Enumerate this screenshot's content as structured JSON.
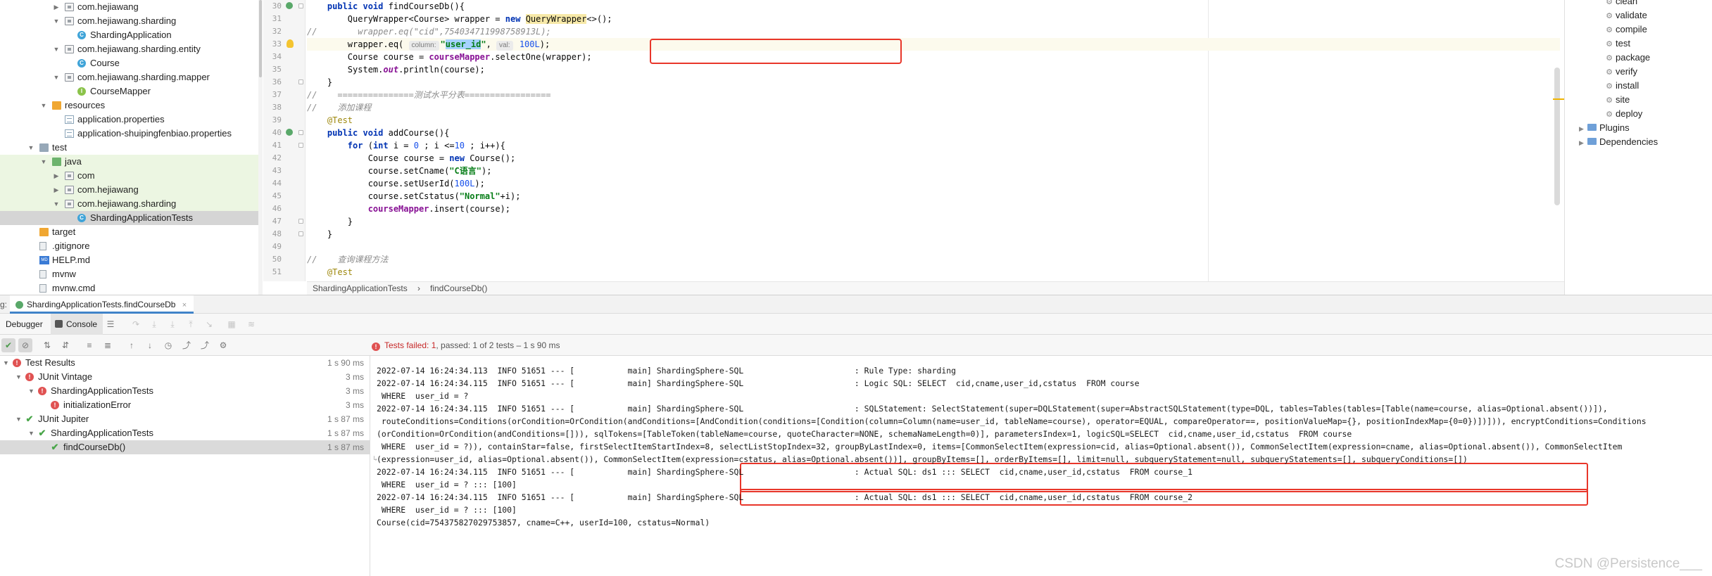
{
  "project_tree": [
    {
      "label": "com.hejiawang",
      "depth": 2,
      "icon": "package-icon",
      "arrow": "▶",
      "style": ""
    },
    {
      "label": "com.hejiawang.sharding",
      "depth": 2,
      "icon": "package-icon",
      "arrow": "▼",
      "style": ""
    },
    {
      "label": "ShardingApplication",
      "depth": 3,
      "icon": "class-icon",
      "arrow": "",
      "style": ""
    },
    {
      "label": "com.hejiawang.sharding.entity",
      "depth": 2,
      "icon": "package-icon",
      "arrow": "▼",
      "style": ""
    },
    {
      "label": "Course",
      "depth": 3,
      "icon": "class-icon",
      "arrow": "",
      "style": ""
    },
    {
      "label": "com.hejiawang.sharding.mapper",
      "depth": 2,
      "icon": "package-icon",
      "arrow": "▼",
      "style": ""
    },
    {
      "label": "CourseMapper",
      "depth": 3,
      "icon": "interface-icon",
      "arrow": "",
      "style": ""
    },
    {
      "label": "resources",
      "depth": 1,
      "icon": "resources-folder-icon",
      "arrow": "▼",
      "style": ""
    },
    {
      "label": "application.properties",
      "depth": 2,
      "icon": "properties-file-icon",
      "arrow": "",
      "style": ""
    },
    {
      "label": "application-shuipingfenbiao.properties",
      "depth": 2,
      "icon": "properties-file-icon",
      "arrow": "",
      "style": ""
    },
    {
      "label": "test",
      "depth": 0,
      "icon": "folder-icon",
      "arrow": "▼",
      "style": ""
    },
    {
      "label": "java",
      "depth": 1,
      "icon": "test-folder-icon",
      "arrow": "▼",
      "style": "green"
    },
    {
      "label": "com",
      "depth": 2,
      "icon": "package-icon",
      "arrow": "▶",
      "style": "green"
    },
    {
      "label": "com.hejiawang",
      "depth": 2,
      "icon": "package-icon",
      "arrow": "▶",
      "style": "green"
    },
    {
      "label": "com.hejiawang.sharding",
      "depth": 2,
      "icon": "package-icon",
      "arrow": "▼",
      "style": "green"
    },
    {
      "label": "ShardingApplicationTests",
      "depth": 3,
      "icon": "class-icon",
      "arrow": "",
      "style": "sel"
    },
    {
      "label": "target",
      "depth": 0,
      "icon": "excluded-folder-icon",
      "arrow": "",
      "style": ""
    },
    {
      "label": ".gitignore",
      "depth": 0,
      "icon": "file-icon",
      "arrow": "",
      "style": ""
    },
    {
      "label": "HELP.md",
      "depth": 0,
      "icon": "markdown-file-icon",
      "arrow": "",
      "style": ""
    },
    {
      "label": "mvnw",
      "depth": 0,
      "icon": "file-icon",
      "arrow": "",
      "style": ""
    },
    {
      "label": "mvnw.cmd",
      "depth": 0,
      "icon": "file-icon",
      "arrow": "",
      "style": ""
    }
  ],
  "editor": {
    "line_numbers": [
      "30",
      "31",
      "32",
      "33",
      "34",
      "35",
      "36",
      "37",
      "38",
      "39",
      "40",
      "41",
      "42",
      "43",
      "44",
      "45",
      "46",
      "47",
      "48",
      "49",
      "50",
      "51"
    ],
    "inlay_column": "column:",
    "inlay_val": "val:",
    "breadcrumb_class": "ShardingApplicationTests",
    "breadcrumb_method": "findCourseDb()"
  },
  "maven": {
    "lifecycle": [
      "clean",
      "validate",
      "compile",
      "test",
      "package",
      "verify",
      "install",
      "site",
      "deploy"
    ],
    "plugins_label": "Plugins",
    "dependencies_label": "Dependencies"
  },
  "run_panel": {
    "tab_prefix": "g:",
    "tab_label": "ShardingApplicationTests.findCourseDb",
    "tab_close": "×",
    "debugger_tab": "Debugger",
    "console_tab": "Console",
    "status_fail": "Tests failed: 1",
    "status_rest": ", passed: 1 of 2 tests – 1 s 90 ms"
  },
  "test_results": [
    {
      "name": "Test Results",
      "time": "1 s 90 ms",
      "depth": 0,
      "status": "fail",
      "arrow": "▼",
      "selected": false
    },
    {
      "name": "JUnit Vintage",
      "time": "3 ms",
      "depth": 1,
      "status": "fail",
      "arrow": "▼",
      "selected": false
    },
    {
      "name": "ShardingApplicationTests",
      "time": "3 ms",
      "depth": 2,
      "status": "fail",
      "arrow": "▼",
      "selected": false
    },
    {
      "name": "initializationError",
      "time": "3 ms",
      "depth": 3,
      "status": "fail",
      "arrow": "",
      "selected": false
    },
    {
      "name": "JUnit Jupiter",
      "time": "1 s 87 ms",
      "depth": 1,
      "status": "pass",
      "arrow": "▼",
      "selected": false
    },
    {
      "name": "ShardingApplicationTests",
      "time": "1 s 87 ms",
      "depth": 2,
      "status": "pass",
      "arrow": "▼",
      "selected": false
    },
    {
      "name": "findCourseDb()",
      "time": "1 s 87 ms",
      "depth": 3,
      "status": "pass",
      "arrow": "",
      "selected": true
    }
  ],
  "console_lines": [
    "2022-07-14 16:24:34.113  INFO 51651 --- [           main] ShardingSphere-SQL                       : Rule Type: sharding",
    "2022-07-14 16:24:34.115  INFO 51651 --- [           main] ShardingSphere-SQL                       : Logic SQL: SELECT  cid,cname,user_id,cstatus  FROM course",
    " WHERE  user_id = ?",
    "2022-07-14 16:24:34.115  INFO 51651 --- [           main] ShardingSphere-SQL                       : SQLStatement: SelectStatement(super=DQLStatement(super=AbstractSQLStatement(type=DQL, tables=Tables(tables=[Table(name=course, alias=Optional.absent())]),",
    " routeConditions=Conditions(orCondition=OrCondition(andConditions=[AndCondition(conditions=[Condition(column=Column(name=user_id, tableName=course), operator=EQUAL, compareOperator==, positionValueMap={}, positionIndexMap={0=0})])])), encryptConditions=Conditions",
    "(orCondition=OrCondition(andConditions=[])), sqlTokens=[TableToken(tableName=course, quoteCharacter=NONE, schemaNameLength=0)], parametersIndex=1, logicSQL=SELECT  cid,cname,user_id,cstatus  FROM course",
    " WHERE  user_id = ?)), containStar=false, firstSelectItemStartIndex=8, selectListStopIndex=32, groupByLastIndex=0, items=[CommonSelectItem(expression=cid, alias=Optional.absent()), CommonSelectItem(expression=cname, alias=Optional.absent()), CommonSelectItem",
    "(expression=user_id, alias=Optional.absent()), CommonSelectItem(expression=cstatus, alias=Optional.absent())], groupByItems=[], orderByItems=[], limit=null, subqueryStatement=null, subqueryStatements=[], subqueryConditions=[])",
    "2022-07-14 16:24:34.115  INFO 51651 --- [           main] ShardingSphere-SQL                       : Actual SQL: ds1 ::: SELECT  cid,cname,user_id,cstatus  FROM course_1",
    " WHERE  user_id = ? ::: [100]",
    "2022-07-14 16:24:34.115  INFO 51651 --- [           main] ShardingSphere-SQL                       : Actual SQL: ds1 ::: SELECT  cid,cname,user_id,cstatus  FROM course_2",
    " WHERE  user_id = ? ::: [100]",
    "Course(cid=754375827029753857, cname=C++, userId=100, cstatus=Normal)"
  ],
  "watermark": "CSDN @Persistence___"
}
